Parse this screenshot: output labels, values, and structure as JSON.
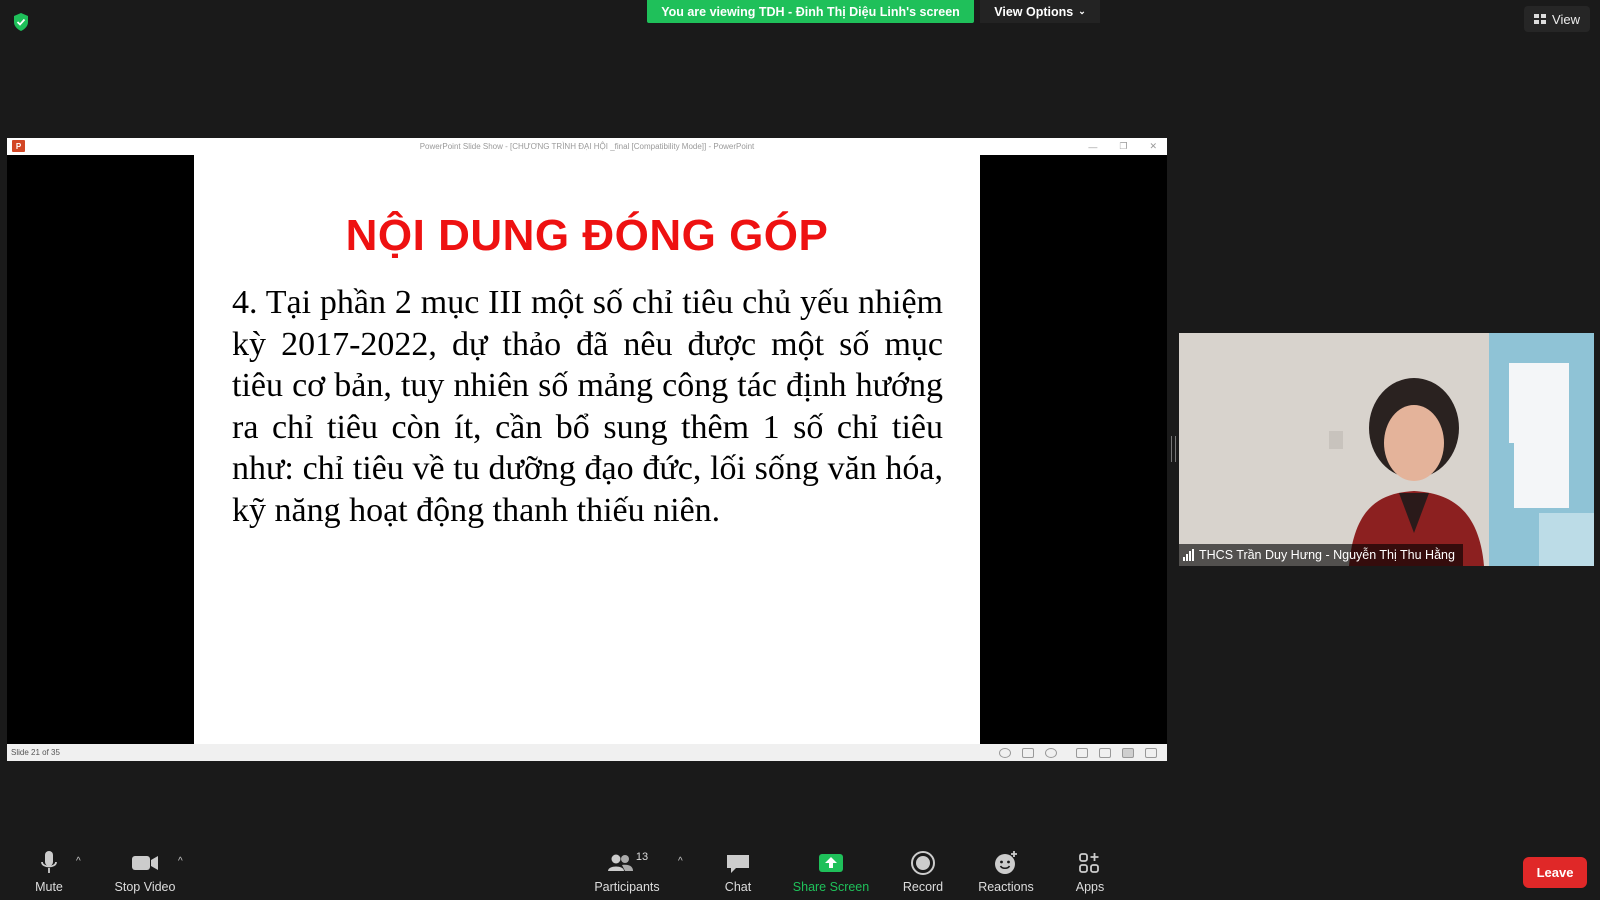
{
  "banner": {
    "text": "You are viewing TDH - Đinh Thị Diệu Linh's screen"
  },
  "view_options": {
    "label": "View Options"
  },
  "view_top": {
    "label": "View"
  },
  "ppt": {
    "window_title": "PowerPoint Slide Show - [CHƯƠNG TRÌNH ĐẠI HỘI _final [Compatibility Mode]] - PowerPoint",
    "slide_title": "NỘI DUNG ĐÓNG GÓP",
    "slide_body": "4. Tại phần 2 mục III một số chỉ tiêu chủ yếu nhiệm kỳ 2017-2022, dự thảo đã nêu được một số mục tiêu cơ bản, tuy nhiên số mảng công tác định hướng ra chỉ tiêu còn ít, cần bổ sung thêm 1 số chỉ tiêu như: chỉ tiêu về tu dưỡng đạo đức, lối sống văn hóa, kỹ năng hoạt động thanh thiếu niên.",
    "slide_counter": "Slide 21 of 35"
  },
  "participant": {
    "name": "THCS Trần Duy Hưng  - Nguyễn Thị Thu Hằng"
  },
  "toolbar": {
    "mute": "Mute",
    "stop_video": "Stop Video",
    "participants": "Participants",
    "participants_count": "13",
    "chat": "Chat",
    "share_screen": "Share Screen",
    "record": "Record",
    "reactions": "Reactions",
    "apps": "Apps",
    "leave": "Leave"
  },
  "colors": {
    "accent_green": "#1fc05a",
    "leave_red": "#e02828",
    "slide_title_red": "#ee1111"
  }
}
